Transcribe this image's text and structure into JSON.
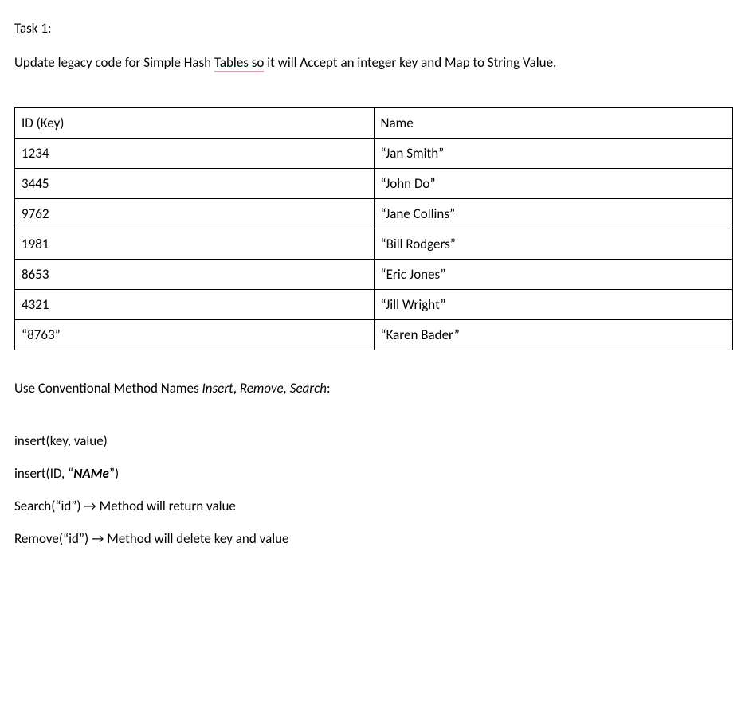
{
  "task_title": "Task 1:",
  "description_pre": "Update legacy code for Simple Hash ",
  "description_underlined": "Tables  so",
  "description_post": " it will Accept an integer key and Map to String Value.",
  "table": {
    "header": {
      "col1": "ID (Key)",
      "col2": "Name"
    },
    "rows": [
      {
        "id": "1234",
        "name": "“Jan Smith”"
      },
      {
        "id": "3445",
        "name": "“John Do”"
      },
      {
        "id": "9762",
        "name": "“Jane Collins”"
      },
      {
        "id": "1981",
        "name": "“Bill Rodgers”"
      },
      {
        "id": "8653",
        "name": "“Eric Jones”"
      },
      {
        "id": "4321",
        "name": "“Jill Wright”"
      },
      {
        "id": "“8763”",
        "name": "“Karen Bader”"
      }
    ]
  },
  "methods_intro_pre": "Use Conventional Method Names ",
  "methods_intro_italic": "Insert",
  "methods_intro_mid": ", ",
  "methods_intro_italic2": "Remove, Search",
  "methods_intro_post": ":",
  "lines": {
    "l1": "insert(key, value)",
    "l2_pre": "insert(ID, “",
    "l2_bold": "NAMe",
    "l2_post": "”)",
    "l3": "Search(“id”) → Method will return value",
    "l4": "Remove(“id”) → Method will delete key and value"
  }
}
